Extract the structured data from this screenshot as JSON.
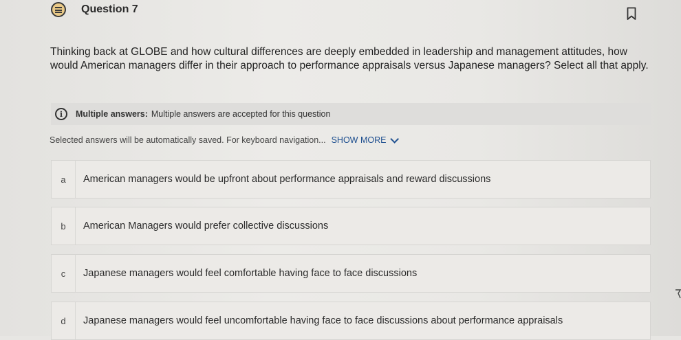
{
  "question": {
    "title": "Question 7",
    "text": "Thinking back at GLOBE and how cultural differences are deeply embedded in leadership and management attitudes, how would American managers differ in their approach to performance appraisals versus Japanese managers? Select all that apply."
  },
  "info": {
    "label": "Multiple answers:",
    "text": "Multiple answers are accepted for this question"
  },
  "autosave": {
    "text": "Selected answers will be automatically saved. For keyboard navigation...",
    "show_more_label": "SHOW MORE"
  },
  "options": [
    {
      "letter": "a",
      "text": "American managers would be upfront about performance appraisals and reward discussions"
    },
    {
      "letter": "b",
      "text": "American Managers would prefer collective discussions"
    },
    {
      "letter": "c",
      "text": "Japanese managers would feel comfortable having face to face discussions"
    },
    {
      "letter": "d",
      "text": "Japanese managers would feel uncomfortable having face to face discussions about performance appraisals"
    }
  ],
  "icons": {
    "question": "question-list-icon",
    "bookmark": "bookmark-icon",
    "info": "info-icon",
    "chevron": "chevron-down-icon"
  },
  "colors": {
    "accent": "#1e4f8f",
    "question_icon_fill": "#e9c987"
  }
}
